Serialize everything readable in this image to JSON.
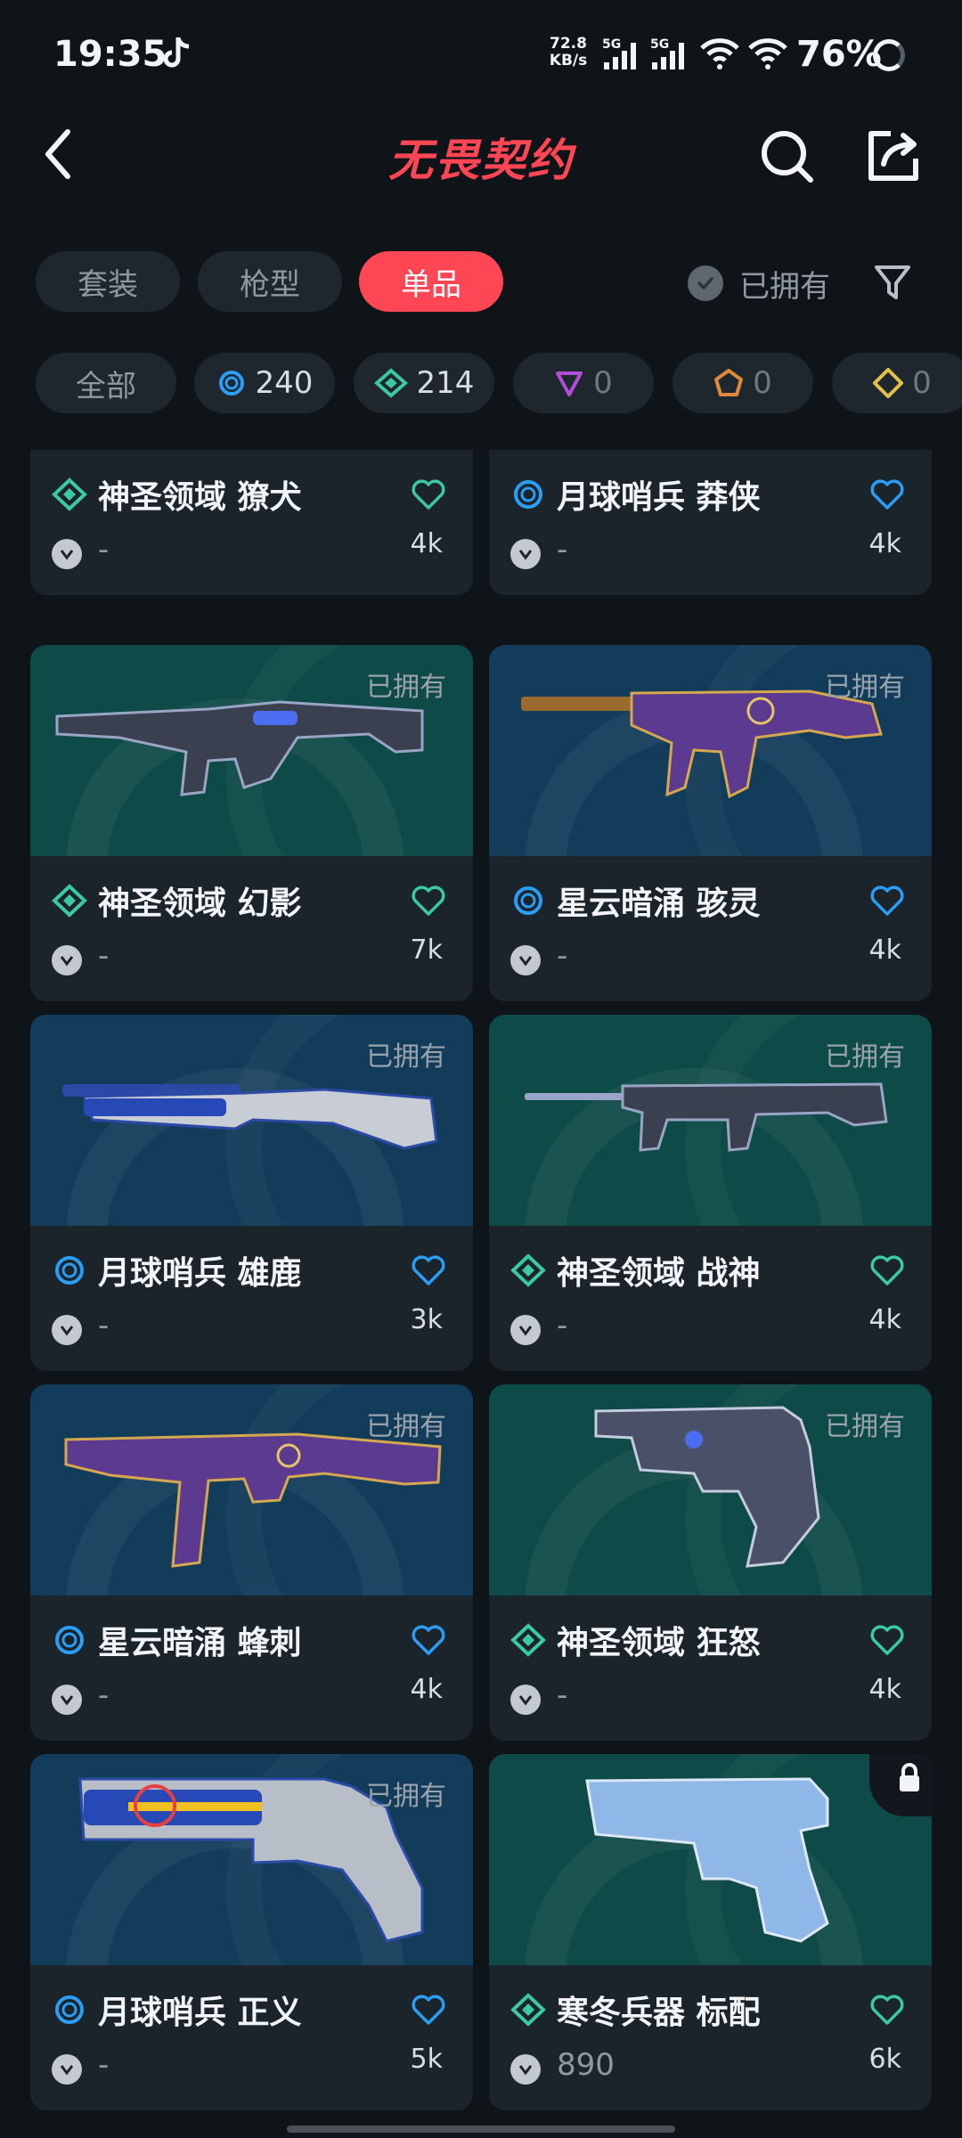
{
  "status_bar": {
    "time": "19:35",
    "net_speed_value": "72.8",
    "net_speed_unit": "KB/s",
    "signal_1_label": "5G",
    "signal_2_label": "5G",
    "battery": "76%"
  },
  "header": {
    "title": "无畏契约"
  },
  "tabs": [
    {
      "label": "套装",
      "active": false
    },
    {
      "label": "枪型",
      "active": false
    },
    {
      "label": "单品",
      "active": true
    }
  ],
  "owned_filter": {
    "label": "已拥有"
  },
  "rarity_filters": {
    "all_label": "全部",
    "select_count": "240",
    "deluxe_count": "214",
    "premium_count": "0",
    "ultra_count": "0",
    "exclusive_count": "0"
  },
  "colors": {
    "accent": "#ff4655",
    "tier_blue": "#2a9df4",
    "tier_green": "#3cc8a0",
    "tier_purple": "#b04fd6",
    "tier_orange": "#e08a3c",
    "tier_gold": "#e3c04a"
  },
  "items": [
    {
      "name": "神圣领域 獠犬",
      "tier": "green",
      "price": "-",
      "likes": "4k",
      "owned": false
    },
    {
      "name": "月球哨兵 莽侠",
      "tier": "blue",
      "price": "-",
      "likes": "4k",
      "owned": false
    },
    {
      "name": "神圣领域 幻影",
      "tier": "green",
      "price": "-",
      "likes": "7k",
      "owned": true,
      "owned_label": "已拥有"
    },
    {
      "name": "星云暗涌 骇灵",
      "tier": "blue",
      "price": "-",
      "likes": "4k",
      "owned": true,
      "owned_label": "已拥有"
    },
    {
      "name": "月球哨兵 雄鹿",
      "tier": "blue",
      "price": "-",
      "likes": "3k",
      "owned": true,
      "owned_label": "已拥有"
    },
    {
      "name": "神圣领域 战神",
      "tier": "green",
      "price": "-",
      "likes": "4k",
      "owned": true,
      "owned_label": "已拥有"
    },
    {
      "name": "星云暗涌 蜂刺",
      "tier": "blue",
      "price": "-",
      "likes": "4k",
      "owned": true,
      "owned_label": "已拥有"
    },
    {
      "name": "神圣领域 狂怒",
      "tier": "green",
      "price": "-",
      "likes": "4k",
      "owned": true,
      "owned_label": "已拥有"
    },
    {
      "name": "月球哨兵 正义",
      "tier": "blue",
      "price": "-",
      "likes": "5k",
      "owned": true,
      "owned_label": "已拥有"
    },
    {
      "name": "寒冬兵器 标配",
      "tier": "green",
      "price": "890",
      "likes": "6k",
      "owned": false,
      "locked": true
    }
  ]
}
